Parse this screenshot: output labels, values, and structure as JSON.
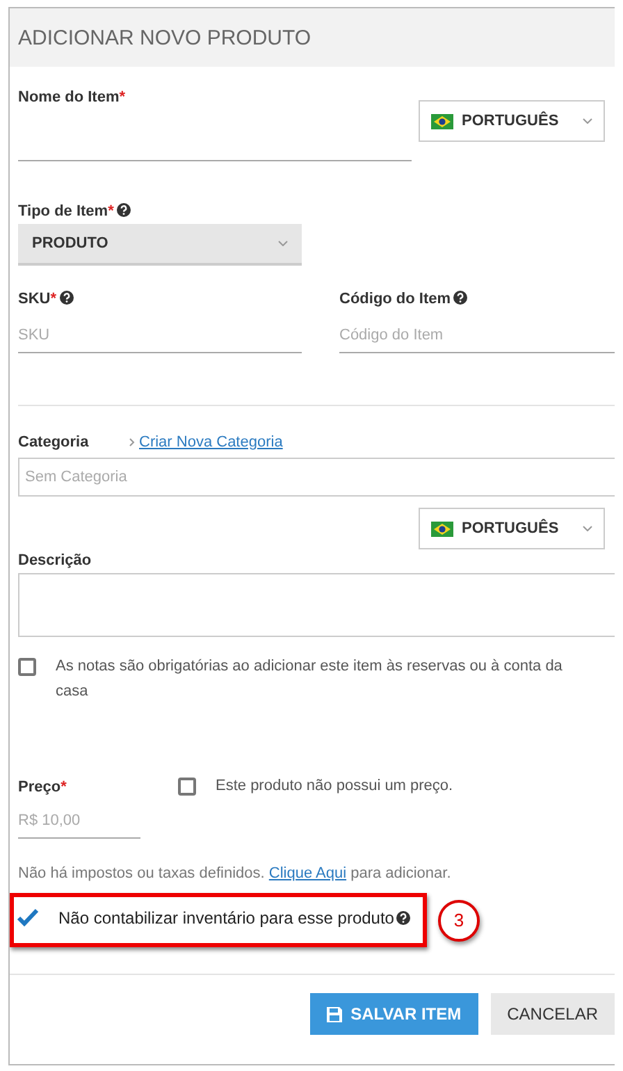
{
  "dialog": {
    "title": "ADICIONAR NOVO PRODUTO"
  },
  "name_field": {
    "label": "Nome do Item",
    "required_mark": "*",
    "language": "PORTUGUÊS"
  },
  "type_field": {
    "label": "Tipo de Item",
    "required_mark": "*",
    "help": true,
    "value": "PRODUTO"
  },
  "sku_field": {
    "label": "SKU",
    "required_mark": "*",
    "help": true,
    "placeholder": "SKU"
  },
  "code_field": {
    "label": "Código do Item",
    "help": true,
    "placeholder": "Código do Item"
  },
  "category_field": {
    "label": "Categoria",
    "link": "Criar Nova Categoria",
    "placeholder": "Sem Categoria"
  },
  "description_field": {
    "label": "Descrição",
    "language": "PORTUGUÊS"
  },
  "notes_required": {
    "label": "As notas são obrigatórias ao adicionar este item às reservas ou à conta da casa",
    "checked": false
  },
  "price_field": {
    "label": "Preço",
    "required_mark": "*",
    "placeholder": "R$ 10,00"
  },
  "no_price": {
    "label": "Este produto não possui um preço.",
    "checked": false
  },
  "taxes_note": {
    "before": "Não há impostos ou taxas definidos.",
    "link": "Clique Aqui",
    "after": "para adicionar."
  },
  "no_inventory": {
    "label": "Não contabilizar inventário para esse produto",
    "help": true,
    "checked": true
  },
  "annotation": {
    "number": "3"
  },
  "buttons": [
    {
      "kind": "primary",
      "label": "SALVAR ITEM"
    },
    {
      "kind": "secondary",
      "label": "CANCELAR"
    }
  ]
}
